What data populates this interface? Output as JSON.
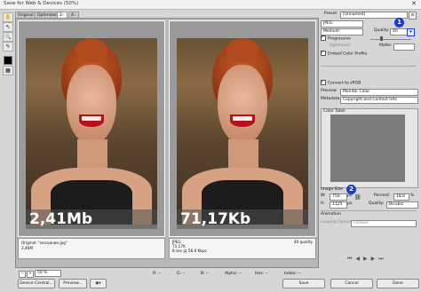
{
  "window": {
    "title": "Save for Web & Devices (50%)"
  },
  "tabs": [
    "Original",
    "Optimized",
    "2-Up",
    "4-Up"
  ],
  "panes": [
    {
      "overlay_size": "2,41Mb",
      "info_left": [
        "Original: \"исходник.jpg\"",
        "2,46M"
      ],
      "info_right": []
    },
    {
      "overlay_size": "71,17Kb",
      "info_left": [
        "JPEG",
        "71,17K",
        "8 sec @ 56.6 Kbps"
      ],
      "info_right": [
        "40 quality"
      ]
    }
  ],
  "bottom": {
    "zoom": "50 %",
    "r_label": "R: --",
    "g_label": "G: --",
    "b_label": "B: --",
    "alpha_label": "Alpha: --",
    "hex_label": "Hex: --",
    "index_label": "Index: --"
  },
  "buttons": {
    "device_central": "Device Central...",
    "preview": "Preview...",
    "save": "Save",
    "cancel": "Cancel",
    "done": "Done"
  },
  "settings": {
    "preset_label": "Preset:",
    "preset_value": "[Unnamed]",
    "format": "JPEG",
    "compression": "Medium",
    "quality_label": "Quality:",
    "quality_value": "40",
    "progressive": "Progressive",
    "optimized": "Optimized",
    "blur_label": "Blur:",
    "blur_value": "0",
    "embed_profile": "Embed Color Profile",
    "matte_label": "Matte:",
    "convert_srgb": "Convert to sRGB",
    "preview_label": "Preview:",
    "preview_value": "Monitor Color",
    "metadata_label": "Metadata:",
    "metadata_value": "Copyright and Contact Info",
    "color_table_label": "Color Table",
    "image_size_label": "Image Size",
    "w_label": "W:",
    "w_value": "750",
    "w_unit": "px",
    "h_label": "H:",
    "h_value": "1125",
    "h_unit": "px",
    "percent_label": "Percent:",
    "percent_value": "18,6",
    "percent_unit": "%",
    "quality2_label": "Quality:",
    "quality2_value": "Bicubic",
    "animation_label": "Animation",
    "looping_label": "Looping Options:",
    "looping_value": "Forever"
  },
  "badges": [
    "1",
    "2"
  ],
  "colors": {
    "badge": "#1a3cd0",
    "lips": "#b5121b",
    "hair": "#b14a1d"
  }
}
